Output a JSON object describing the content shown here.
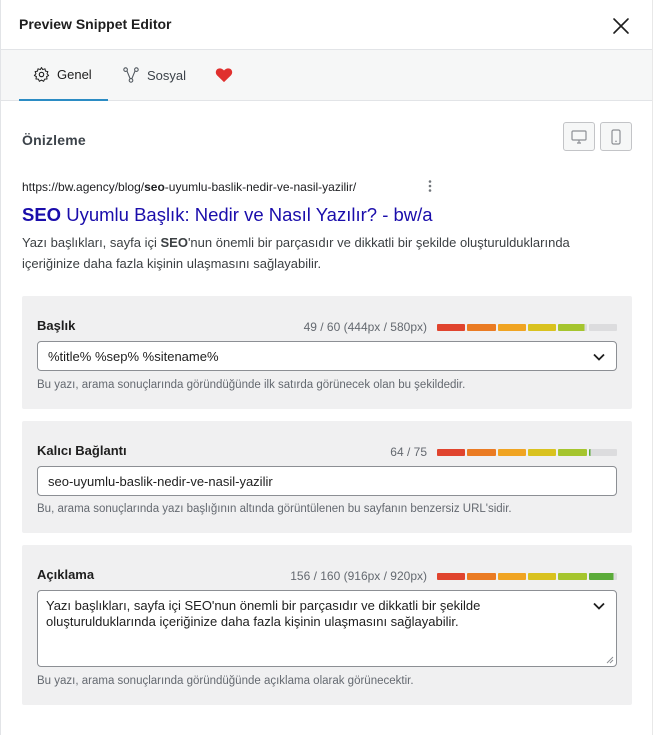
{
  "modal": {
    "title": "Preview Snippet Editor",
    "close_icon": "close-icon"
  },
  "tabs": [
    {
      "label": "Genel",
      "icon": "gear-icon",
      "active": true
    },
    {
      "label": "Sosyal",
      "icon": "share-icon",
      "active": false
    },
    {
      "label": "",
      "icon": "heart-icon",
      "active": false
    }
  ],
  "preview": {
    "heading": "Önizleme",
    "device_buttons": [
      "desktop-icon",
      "mobile-icon"
    ],
    "url_prefix": "https://bw.agency/blog/",
    "url_keyword": "seo",
    "url_suffix": "-uyumlu-baslik-nedir-ve-nasil-yazilir/",
    "title_keyword": "SEO",
    "title_rest": " Uyumlu Başlık: Nedir ve Nasıl Yazılır? - bw/a",
    "desc_part1": "Yazı başlıkları, sayfa içi ",
    "desc_keyword": "SEO",
    "desc_part2": "'nun önemli bir parçasıdır ve dikkatli bir şekilde oluşturulduklarında içeriğinize daha fazla kişinin ulaşmasını sağlayabilir."
  },
  "fields": {
    "title": {
      "label": "Başlık",
      "count": "49 / 60 (444px / 580px)",
      "value": "%title% %sep% %sitename%",
      "help": "Bu yazı, arama sonuçlarında göründüğünde ilk satırda görünecek olan bu şekildedir.",
      "meter_fill": 0.82
    },
    "permalink": {
      "label": "Kalıcı Bağlantı",
      "count": "64 / 75",
      "value": "seo-uyumlu-baslik-nedir-ve-nasil-yazilir",
      "help": "Bu, arama sonuçlarında yazı başlığının altında görüntülenen bu sayfanın benzersiz URL'sidir.",
      "meter_fill": 0.85
    },
    "description": {
      "label": "Açıklama",
      "count": "156 / 160 (916px / 920px)",
      "value": "Yazı başlıkları, sayfa içi SEO'nun önemli bir parçasıdır ve dikkatli bir şekilde oluşturulduklarında içeriğinize daha fazla kişinin ulaşmasını sağlayabilir.",
      "help": "Bu yazı, arama sonuçlarında göründüğünde açıklama olarak görünecektir.",
      "meter_fill": 0.98
    }
  },
  "colors": {
    "meter_segments": [
      "#e0442e",
      "#ea7b23",
      "#f0a422",
      "#d9c21f",
      "#a5c52e",
      "#5bab3a"
    ],
    "meter_empty": "#dcdcde",
    "accent": "#2b8cc4",
    "serp_title": "#1a0dab",
    "heart": "#e0302e"
  }
}
